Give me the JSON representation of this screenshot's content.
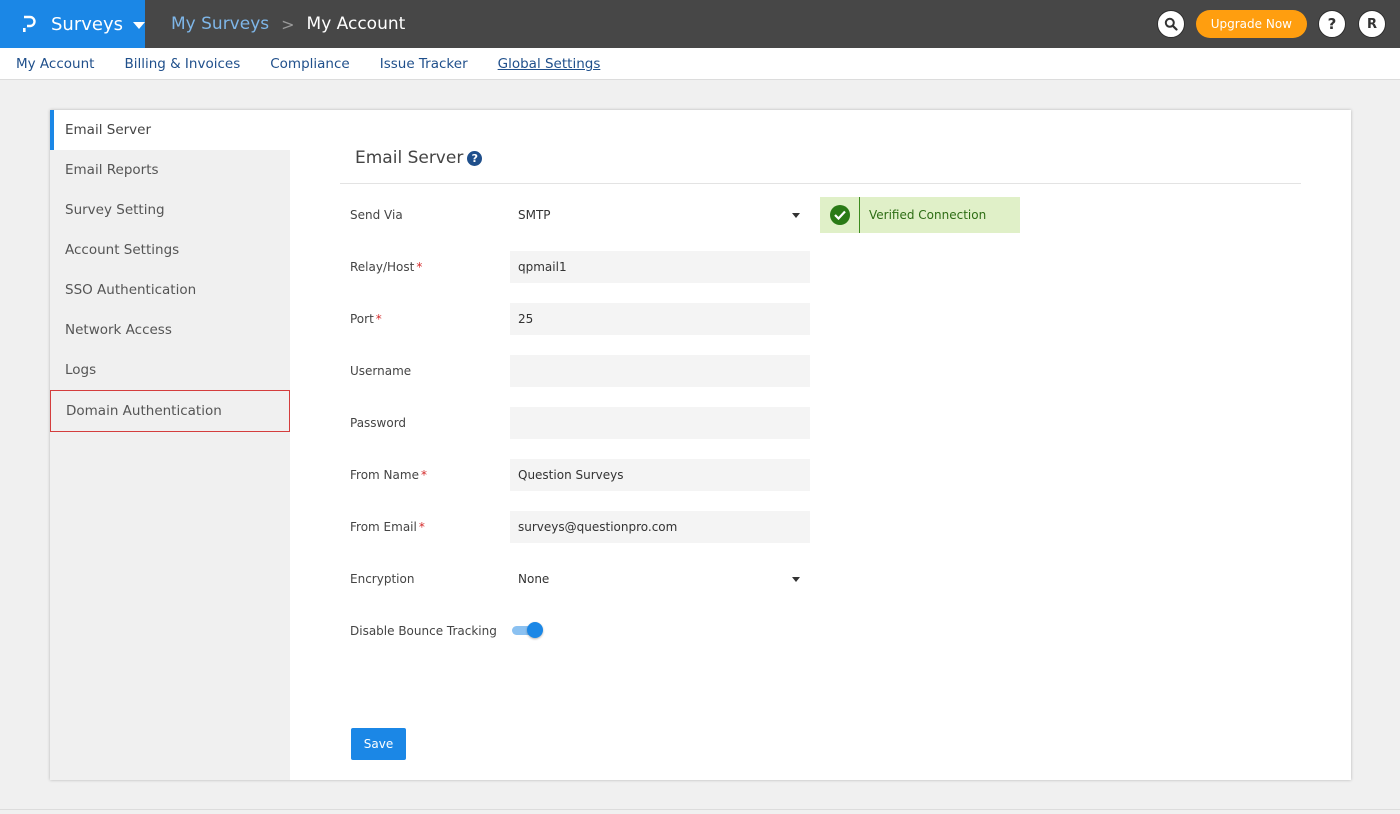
{
  "header": {
    "product_name": "Surveys",
    "breadcrumb_link": "My Surveys",
    "breadcrumb_separator": ">",
    "breadcrumb_current": "My Account",
    "upgrade_label": "Upgrade Now",
    "help_label": "?",
    "avatar_initial": "R",
    "colors": {
      "brand": "#1b87e6",
      "bar": "#474747",
      "upgrade": "#ff9e0f"
    }
  },
  "subnav": {
    "items": [
      {
        "label": "My Account"
      },
      {
        "label": "Billing & Invoices"
      },
      {
        "label": "Compliance"
      },
      {
        "label": "Issue Tracker"
      },
      {
        "label": "Global Settings",
        "active": true
      }
    ]
  },
  "sidebar": {
    "items": [
      {
        "label": "Email Server",
        "active": true
      },
      {
        "label": "Email Reports"
      },
      {
        "label": "Survey Setting"
      },
      {
        "label": "Account Settings"
      },
      {
        "label": "SSO Authentication"
      },
      {
        "label": "Network Access"
      },
      {
        "label": "Logs"
      },
      {
        "label": "Domain Authentication",
        "highlighted": true
      }
    ]
  },
  "form": {
    "title": "Email Server",
    "help_icon": "?",
    "send_via": {
      "label": "Send Via",
      "value": "SMTP"
    },
    "status": {
      "text": "Verified Connection",
      "icon": "check-circle-icon",
      "color": "#2a7a16"
    },
    "relay_host": {
      "label": "Relay/Host",
      "required": "*",
      "value": "qpmail1"
    },
    "port": {
      "label": "Port",
      "required": "*",
      "value": "25"
    },
    "username": {
      "label": "Username",
      "value": ""
    },
    "password": {
      "label": "Password",
      "value": ""
    },
    "from_name": {
      "label": "From Name",
      "required": "*",
      "value": "Question Surveys"
    },
    "from_email": {
      "label": "From Email",
      "required": "*",
      "value": "surveys@questionpro.com"
    },
    "encryption": {
      "label": "Encryption",
      "value": "None"
    },
    "disable_bounce": {
      "label": "Disable Bounce Tracking",
      "enabled": true
    },
    "save_label": "Save"
  }
}
